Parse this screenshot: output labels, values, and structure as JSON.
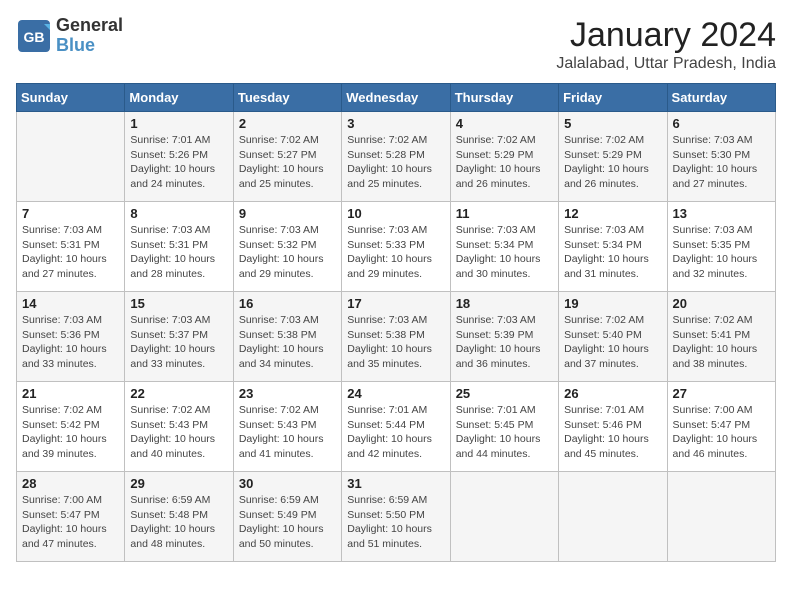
{
  "logo": {
    "text_general": "General",
    "text_blue": "Blue"
  },
  "header": {
    "month_year": "January 2024",
    "location": "Jalalabad, Uttar Pradesh, India"
  },
  "days_of_week": [
    "Sunday",
    "Monday",
    "Tuesday",
    "Wednesday",
    "Thursday",
    "Friday",
    "Saturday"
  ],
  "weeks": [
    [
      {
        "day": "",
        "sunrise": "",
        "sunset": "",
        "daylight": ""
      },
      {
        "day": "1",
        "sunrise": "Sunrise: 7:01 AM",
        "sunset": "Sunset: 5:26 PM",
        "daylight": "Daylight: 10 hours and 24 minutes."
      },
      {
        "day": "2",
        "sunrise": "Sunrise: 7:02 AM",
        "sunset": "Sunset: 5:27 PM",
        "daylight": "Daylight: 10 hours and 25 minutes."
      },
      {
        "day": "3",
        "sunrise": "Sunrise: 7:02 AM",
        "sunset": "Sunset: 5:28 PM",
        "daylight": "Daylight: 10 hours and 25 minutes."
      },
      {
        "day": "4",
        "sunrise": "Sunrise: 7:02 AM",
        "sunset": "Sunset: 5:29 PM",
        "daylight": "Daylight: 10 hours and 26 minutes."
      },
      {
        "day": "5",
        "sunrise": "Sunrise: 7:02 AM",
        "sunset": "Sunset: 5:29 PM",
        "daylight": "Daylight: 10 hours and 26 minutes."
      },
      {
        "day": "6",
        "sunrise": "Sunrise: 7:03 AM",
        "sunset": "Sunset: 5:30 PM",
        "daylight": "Daylight: 10 hours and 27 minutes."
      }
    ],
    [
      {
        "day": "7",
        "sunrise": "Sunrise: 7:03 AM",
        "sunset": "Sunset: 5:31 PM",
        "daylight": "Daylight: 10 hours and 27 minutes."
      },
      {
        "day": "8",
        "sunrise": "Sunrise: 7:03 AM",
        "sunset": "Sunset: 5:31 PM",
        "daylight": "Daylight: 10 hours and 28 minutes."
      },
      {
        "day": "9",
        "sunrise": "Sunrise: 7:03 AM",
        "sunset": "Sunset: 5:32 PM",
        "daylight": "Daylight: 10 hours and 29 minutes."
      },
      {
        "day": "10",
        "sunrise": "Sunrise: 7:03 AM",
        "sunset": "Sunset: 5:33 PM",
        "daylight": "Daylight: 10 hours and 29 minutes."
      },
      {
        "day": "11",
        "sunrise": "Sunrise: 7:03 AM",
        "sunset": "Sunset: 5:34 PM",
        "daylight": "Daylight: 10 hours and 30 minutes."
      },
      {
        "day": "12",
        "sunrise": "Sunrise: 7:03 AM",
        "sunset": "Sunset: 5:34 PM",
        "daylight": "Daylight: 10 hours and 31 minutes."
      },
      {
        "day": "13",
        "sunrise": "Sunrise: 7:03 AM",
        "sunset": "Sunset: 5:35 PM",
        "daylight": "Daylight: 10 hours and 32 minutes."
      }
    ],
    [
      {
        "day": "14",
        "sunrise": "Sunrise: 7:03 AM",
        "sunset": "Sunset: 5:36 PM",
        "daylight": "Daylight: 10 hours and 33 minutes."
      },
      {
        "day": "15",
        "sunrise": "Sunrise: 7:03 AM",
        "sunset": "Sunset: 5:37 PM",
        "daylight": "Daylight: 10 hours and 33 minutes."
      },
      {
        "day": "16",
        "sunrise": "Sunrise: 7:03 AM",
        "sunset": "Sunset: 5:38 PM",
        "daylight": "Daylight: 10 hours and 34 minutes."
      },
      {
        "day": "17",
        "sunrise": "Sunrise: 7:03 AM",
        "sunset": "Sunset: 5:38 PM",
        "daylight": "Daylight: 10 hours and 35 minutes."
      },
      {
        "day": "18",
        "sunrise": "Sunrise: 7:03 AM",
        "sunset": "Sunset: 5:39 PM",
        "daylight": "Daylight: 10 hours and 36 minutes."
      },
      {
        "day": "19",
        "sunrise": "Sunrise: 7:02 AM",
        "sunset": "Sunset: 5:40 PM",
        "daylight": "Daylight: 10 hours and 37 minutes."
      },
      {
        "day": "20",
        "sunrise": "Sunrise: 7:02 AM",
        "sunset": "Sunset: 5:41 PM",
        "daylight": "Daylight: 10 hours and 38 minutes."
      }
    ],
    [
      {
        "day": "21",
        "sunrise": "Sunrise: 7:02 AM",
        "sunset": "Sunset: 5:42 PM",
        "daylight": "Daylight: 10 hours and 39 minutes."
      },
      {
        "day": "22",
        "sunrise": "Sunrise: 7:02 AM",
        "sunset": "Sunset: 5:43 PM",
        "daylight": "Daylight: 10 hours and 40 minutes."
      },
      {
        "day": "23",
        "sunrise": "Sunrise: 7:02 AM",
        "sunset": "Sunset: 5:43 PM",
        "daylight": "Daylight: 10 hours and 41 minutes."
      },
      {
        "day": "24",
        "sunrise": "Sunrise: 7:01 AM",
        "sunset": "Sunset: 5:44 PM",
        "daylight": "Daylight: 10 hours and 42 minutes."
      },
      {
        "day": "25",
        "sunrise": "Sunrise: 7:01 AM",
        "sunset": "Sunset: 5:45 PM",
        "daylight": "Daylight: 10 hours and 44 minutes."
      },
      {
        "day": "26",
        "sunrise": "Sunrise: 7:01 AM",
        "sunset": "Sunset: 5:46 PM",
        "daylight": "Daylight: 10 hours and 45 minutes."
      },
      {
        "day": "27",
        "sunrise": "Sunrise: 7:00 AM",
        "sunset": "Sunset: 5:47 PM",
        "daylight": "Daylight: 10 hours and 46 minutes."
      }
    ],
    [
      {
        "day": "28",
        "sunrise": "Sunrise: 7:00 AM",
        "sunset": "Sunset: 5:47 PM",
        "daylight": "Daylight: 10 hours and 47 minutes."
      },
      {
        "day": "29",
        "sunrise": "Sunrise: 6:59 AM",
        "sunset": "Sunset: 5:48 PM",
        "daylight": "Daylight: 10 hours and 48 minutes."
      },
      {
        "day": "30",
        "sunrise": "Sunrise: 6:59 AM",
        "sunset": "Sunset: 5:49 PM",
        "daylight": "Daylight: 10 hours and 50 minutes."
      },
      {
        "day": "31",
        "sunrise": "Sunrise: 6:59 AM",
        "sunset": "Sunset: 5:50 PM",
        "daylight": "Daylight: 10 hours and 51 minutes."
      },
      {
        "day": "",
        "sunrise": "",
        "sunset": "",
        "daylight": ""
      },
      {
        "day": "",
        "sunrise": "",
        "sunset": "",
        "daylight": ""
      },
      {
        "day": "",
        "sunrise": "",
        "sunset": "",
        "daylight": ""
      }
    ]
  ]
}
